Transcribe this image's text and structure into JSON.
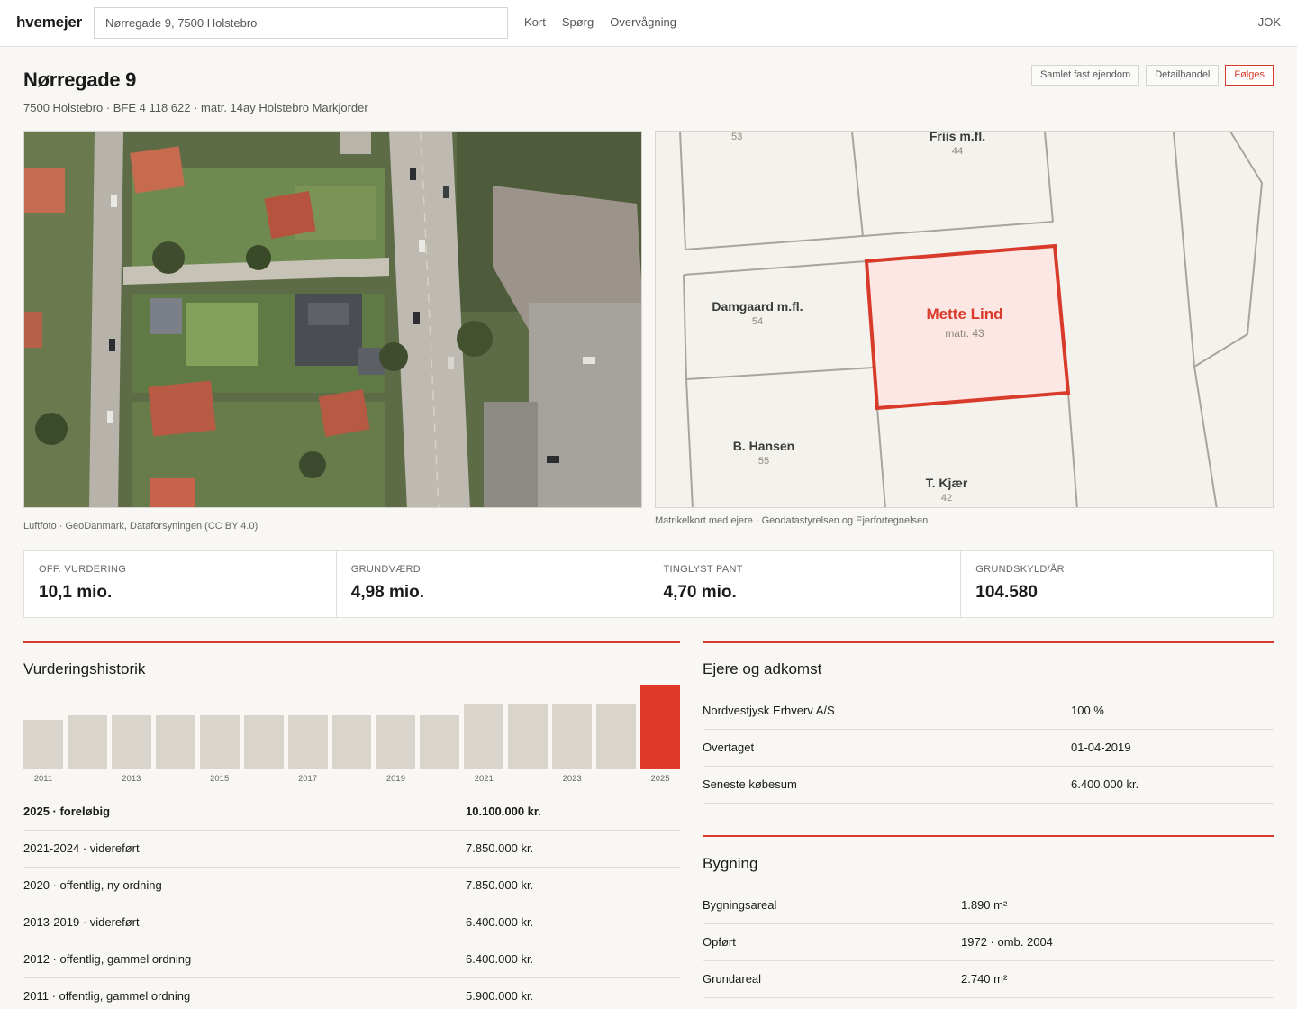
{
  "app": {
    "logo": "hvemejer",
    "user": "JOK"
  },
  "search": {
    "value": "Nørregade 9, 7500 Holstebro"
  },
  "nav": [
    "Kort",
    "Spørg",
    "Overvågning"
  ],
  "header": {
    "title": "Nørregade 9",
    "subtitle": "7500 Holstebro · BFE 4 118 622 · matr. 14ay Holstebro Markjorder",
    "actions": [
      "Samlet fast ejendom",
      "Detailhandel",
      "Følges"
    ]
  },
  "photo": {
    "caption": "Luftfoto · GeoDanmark, Dataforsyningen (CC BY 4.0)"
  },
  "map": {
    "caption": "Matrikelkort med ejere · Geodatastyrelsen og Ejerfortegnelsen",
    "parcels": [
      {
        "owner": "",
        "number": "53"
      },
      {
        "owner": "Friis m.fl.",
        "number": "44"
      },
      {
        "owner": "Damgaard m.fl.",
        "number": "54"
      },
      {
        "owner": "Mette Lind",
        "number": "matr. 43"
      },
      {
        "owner": "B. Hansen",
        "number": "55"
      },
      {
        "owner": "T. Kjær",
        "number": "42"
      }
    ],
    "highlight_color": "#d93b2b"
  },
  "stats": [
    {
      "label": "OFF. VURDERING",
      "value": "10,1 mio."
    },
    {
      "label": "GRUNDVÆRDI",
      "value": "4,98 mio."
    },
    {
      "label": "TINGLYST PANT",
      "value": "4,70 mio."
    },
    {
      "label": "GRUNDSKYLD/ÅR",
      "value": "104.580"
    }
  ],
  "history": {
    "title": "Vurderingshistorik",
    "rows": [
      {
        "label": "2025 · foreløbig",
        "value": "10.100.000 kr."
      },
      {
        "label": "2021-2024 · videreført",
        "value": "7.850.000 kr."
      },
      {
        "label": "2020 · offentlig, ny ordning",
        "value": "7.850.000 kr."
      },
      {
        "label": "2013-2019 · videreført",
        "value": "6.400.000 kr."
      },
      {
        "label": "2012 · offentlig, gammel ordning",
        "value": "6.400.000 kr."
      },
      {
        "label": "2011 · offentlig, gammel ordning",
        "value": "5.900.000 kr."
      }
    ]
  },
  "chart_data": {
    "type": "bar",
    "categories": [
      "2011",
      "2012",
      "2013",
      "2014",
      "2015",
      "2016",
      "2017",
      "2018",
      "2019",
      "2020",
      "2021",
      "2022",
      "2023",
      "2024",
      "2025"
    ],
    "tick_labels": [
      "2011",
      "2013",
      "2015",
      "2017",
      "2019",
      "2021",
      "2023",
      "2025"
    ],
    "values": [
      5.9,
      6.4,
      6.4,
      6.4,
      6.4,
      6.4,
      6.4,
      6.4,
      6.4,
      6.4,
      7.85,
      7.85,
      7.85,
      7.85,
      10.1
    ],
    "ylim": [
      0,
      10.1
    ],
    "highlight_category": "2025",
    "bar_color": "#d9d5cc",
    "highlight_color": "#e0392a",
    "grid": false
  },
  "owners": {
    "title": "Ejere og adkomst",
    "rows": [
      {
        "label": "Nordvestjysk Erhverv A/S",
        "value": "100 %"
      },
      {
        "label": "Overtaget",
        "value": "01-04-2019"
      },
      {
        "label": "Seneste købesum",
        "value": "6.400.000 kr."
      }
    ]
  },
  "building": {
    "title": "Bygning",
    "rows": [
      {
        "label": "Bygningsareal",
        "value": "1.890 m²"
      },
      {
        "label": "Opført",
        "value": "1972 · omb. 2004"
      },
      {
        "label": "Grundareal",
        "value": "2.740 m²"
      }
    ]
  }
}
